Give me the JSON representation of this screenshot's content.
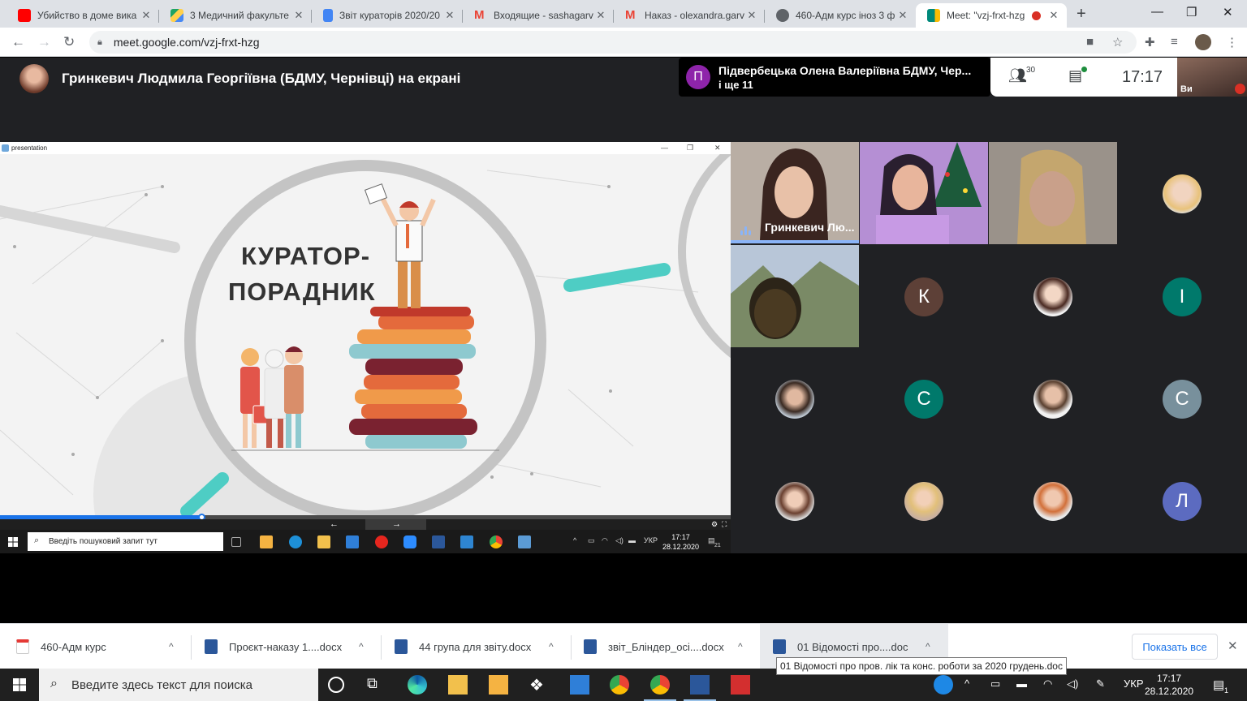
{
  "browser": {
    "tabs": [
      {
        "title": "Убийство в доме вика",
        "color": "#ff0000"
      },
      {
        "title": "3 Медичний факульте",
        "color": "#1fa463"
      },
      {
        "title": "Звіт кураторів 2020/20",
        "color": "#4285f4"
      },
      {
        "title": "Входящие - sashagarv",
        "color": "#ea4335"
      },
      {
        "title": "Наказ - olexandra.garv",
        "color": "#ea4335"
      },
      {
        "title": "460-Адм курс іноз 3 ф",
        "color": "#5f6368"
      },
      {
        "title": "Meet: \"vzj-frxt-hzg",
        "color": "#00897b",
        "active": true
      }
    ],
    "url": "meet.google.com/vzj-frxt-hzg"
  },
  "meet": {
    "presenter_label": "Гринкевич Людмила Георгіївна (БДМУ, Чернівці) на екрані",
    "notification": {
      "avatar_letter": "П",
      "line1": "Підвербецька Олена Валеріївна БДМУ, Чер...",
      "line2": "і ще 11"
    },
    "participant_count": "30",
    "time": "17:17",
    "self_label": "Ви",
    "speaker_name": "Гринкевич Лю...",
    "letters": {
      "k": "К",
      "i": "І",
      "s1": "С",
      "s2": "С",
      "l": "Л"
    }
  },
  "presentation": {
    "window_title": "presentation",
    "slide_title_1": "КУРАТОР-",
    "slide_title_2": "ПОРАДНИК",
    "progress": 0.276
  },
  "inner_taskbar": {
    "search_placeholder": "Введіть пошуковий запит тут",
    "lang": "УКР",
    "time": "17:17",
    "date": "28.12.2020",
    "notif_count": "21"
  },
  "downloads": {
    "items": [
      {
        "name": "460-Адм курс",
        "type": "pdf"
      },
      {
        "name": "Проєкт-наказу 1....docx",
        "type": "docx"
      },
      {
        "name": "44 група для звіту.docx",
        "type": "docx"
      },
      {
        "name": "звіт_Бліндер_осі....docx",
        "type": "docx"
      },
      {
        "name": "01 Відомості про....doc",
        "type": "doc"
      }
    ],
    "show_all": "Показать все",
    "tooltip": "01 Відомості про пров. лік та конс. роботи за 2020 грудень.doc"
  },
  "taskbar": {
    "search_placeholder": "Введите здесь текст для поиска",
    "lang": "УКР",
    "time": "17:17",
    "date": "28.12.2020",
    "notif_count": "1"
  },
  "colors": {
    "meet_bg": "#202124",
    "brown_avatar": "#5d4037",
    "teal_avatar": "#00796b",
    "grey_avatar": "#78909c",
    "indigo_avatar": "#5c6bc0",
    "accent_teal": "#4ecdc4"
  }
}
